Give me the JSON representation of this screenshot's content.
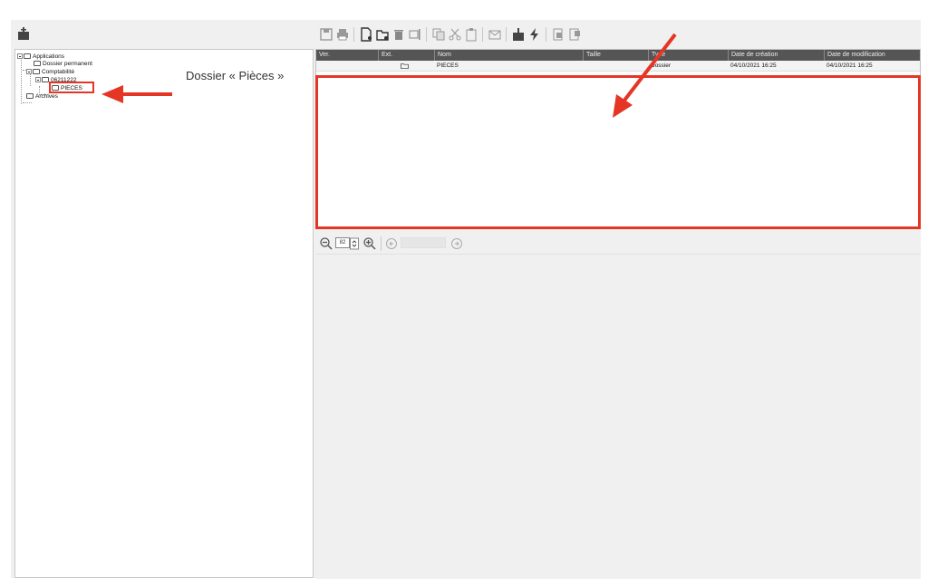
{
  "tree": {
    "nodes": [
      {
        "label": "Applications"
      },
      {
        "label": "Dossier permanent"
      },
      {
        "label": "Comptabilité"
      },
      {
        "label": "06211222"
      },
      {
        "label": "PIECES"
      },
      {
        "label": "Archives"
      }
    ]
  },
  "annotation": {
    "label": "Dossier « Pièces »",
    "color": "#e53525"
  },
  "toolbar": {
    "icons": [
      "save-icon",
      "print-icon",
      "new-document-icon",
      "new-folder-icon",
      "delete-icon",
      "rename-icon",
      "copy-icon",
      "cut-icon",
      "paste-icon",
      "mail-icon",
      "archive-icon",
      "lightning-icon",
      "import-icon",
      "export-icon"
    ]
  },
  "grid": {
    "columns": [
      "Ver.",
      "Ext.",
      "Nom",
      "Taille",
      "Type",
      "Date de création",
      "Date de modification"
    ],
    "rows": [
      {
        "version": "",
        "ext_icon": "folder-icon",
        "name": "PIECES",
        "size": "",
        "type": "Dossier",
        "created": "04/10/2021 16:25",
        "modified": "04/10/2021 16:25"
      }
    ]
  },
  "viewer": {
    "zoom_value": "82"
  }
}
